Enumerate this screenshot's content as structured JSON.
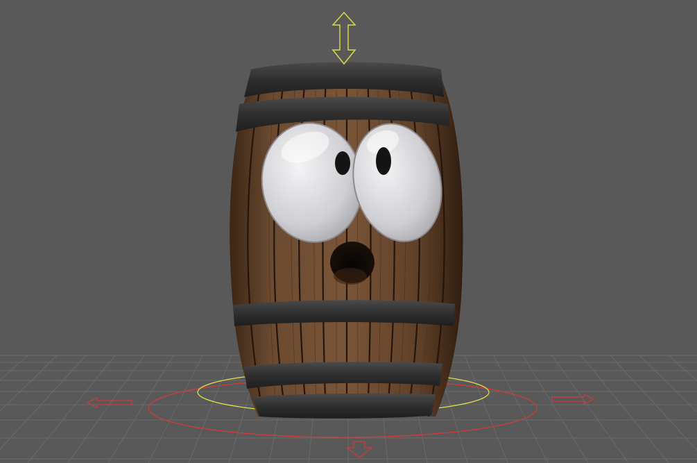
{
  "viewport": {
    "background_color": "#595959",
    "grid_color": "#6b6b6b",
    "grid_horizon_color": "#707070"
  },
  "object": {
    "name": "barrel-character",
    "wood_color": "#5a3b24",
    "wood_dark_color": "#2e1d12",
    "hoop_color": "#2c2c2c",
    "eye_color": "#d8d8dc",
    "pupil_color": "#141414"
  },
  "gizmos": {
    "translate_y_arrow_icon": "arrow-up-down-icon",
    "translate_y_color": "#d9d94a",
    "pivot_ring_color": "#e3e34a",
    "ground_ring_color": "#d23a3a",
    "translate_x_left_icon": "arrow-left-icon",
    "translate_x_right_icon": "arrow-right-icon",
    "translate_z_icon": "arrow-down-icon"
  }
}
